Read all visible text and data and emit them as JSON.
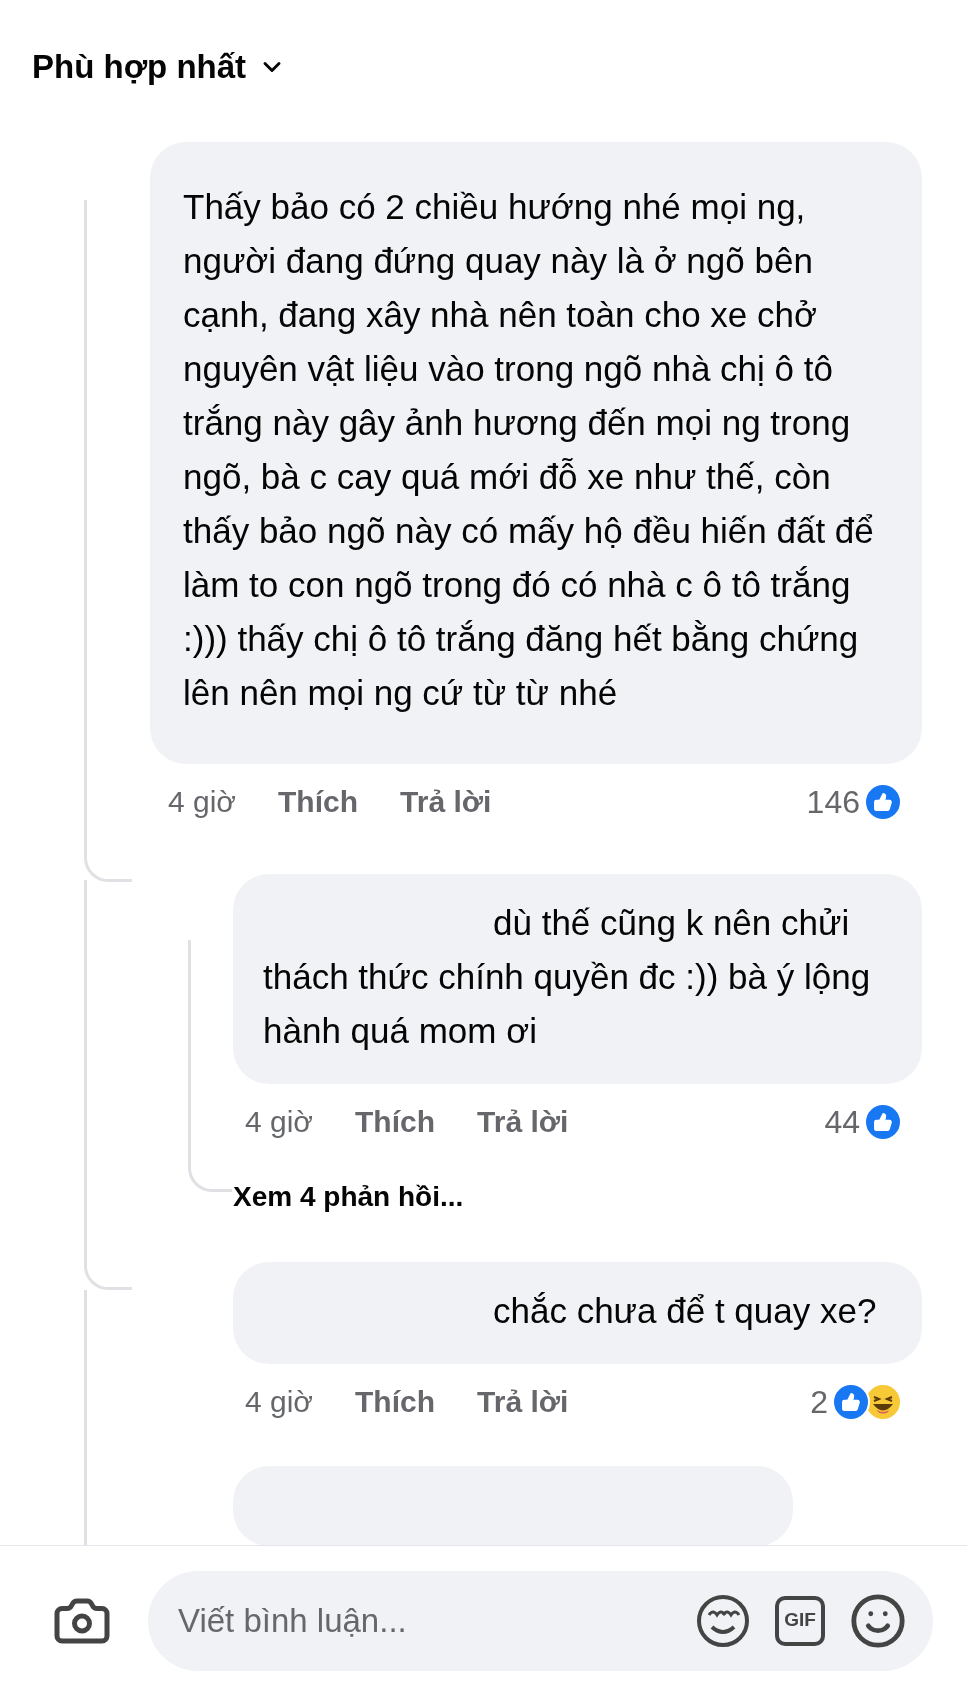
{
  "sort": {
    "label": "Phù hợp nhất"
  },
  "comments": [
    {
      "text": "Thấy bảo có 2 chiều hướng nhé mọi ng, người đang đứng quay này là ở ngõ bên cạnh, đang xây nhà nên toàn cho xe chở nguyên vật liệu vào trong ngõ nhà chị ô tô trắng này gây ảnh hương đến mọi ng trong ngõ, bà c cay quá mới đỗ xe như thế, còn thấy bảo ngõ này có mấy hộ đều hiến đất để làm to con ngõ trong đó có nhà c ô tô trắng :))) thấy chị ô tô trắng đăng hết bằng chứng lên nên mọi ng cứ từ từ nhé",
      "time": "4 giờ",
      "like": "Thích",
      "reply": "Trả lời",
      "count": "146",
      "reactions": [
        {
          "kind": "like"
        }
      ],
      "children": [
        {
          "text": "dù thế cũng k nên chửi thách thức chính quyền đc :)) bà ý lộng hành quá mom ơi",
          "time": "4 giờ",
          "like": "Thích",
          "reply": "Trả lời",
          "count": "44",
          "reactions": [
            {
              "kind": "like"
            }
          ],
          "more_replies": "Xem 4 phản hồi..."
        },
        {
          "text": "chắc chưa để t quay xe?",
          "time": "4 giờ",
          "like": "Thích",
          "reply": "Trả lời",
          "count": "2",
          "reactions": [
            {
              "kind": "like"
            },
            {
              "kind": "haha"
            }
          ]
        }
      ]
    }
  ],
  "composer": {
    "placeholder": "Viết bình luận...",
    "gif_label": "GIF"
  }
}
